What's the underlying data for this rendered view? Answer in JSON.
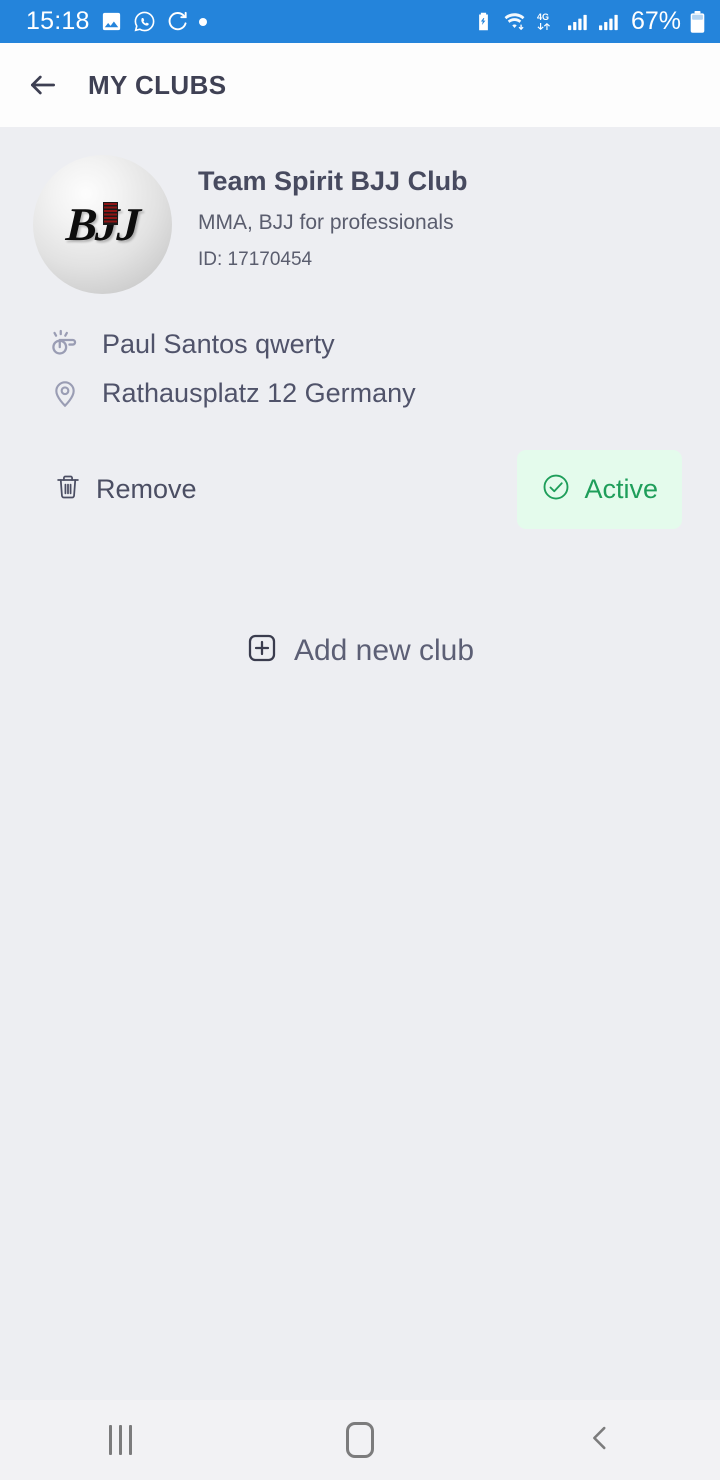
{
  "status_bar": {
    "time": "15:18",
    "battery_percent": "67%",
    "network": "4G",
    "icons": [
      "gallery-icon",
      "whatsapp-icon",
      "sync-icon",
      "dot-icon",
      "battery-saver-icon",
      "wifi-icon",
      "signal-icon-1",
      "signal-icon-2",
      "battery-icon"
    ],
    "accent_color": "#2484db"
  },
  "header": {
    "title": "MY CLUBS",
    "back_icon": "back-arrow-icon"
  },
  "club": {
    "avatar_text": "BJJ",
    "name": "Team Spirit BJJ Club",
    "description": "MMA, BJJ for professionals",
    "id_label": "ID: 17170454",
    "coach": "Paul Santos qwerty",
    "address": "Rathausplatz 12 Germany",
    "coach_icon": "whistle-icon",
    "address_icon": "location-pin-icon"
  },
  "actions": {
    "remove_label": "Remove",
    "remove_icon": "trash-icon",
    "status_label": "Active",
    "status_icon": "check-circle-icon",
    "status_color": "#1e9e5a",
    "status_bg": "#e4fbec",
    "add_label": "Add new club",
    "add_icon": "plus-square-icon"
  },
  "navigation_bar": {
    "recents_label": "Recents",
    "home_label": "Home",
    "back_label": "Back"
  }
}
